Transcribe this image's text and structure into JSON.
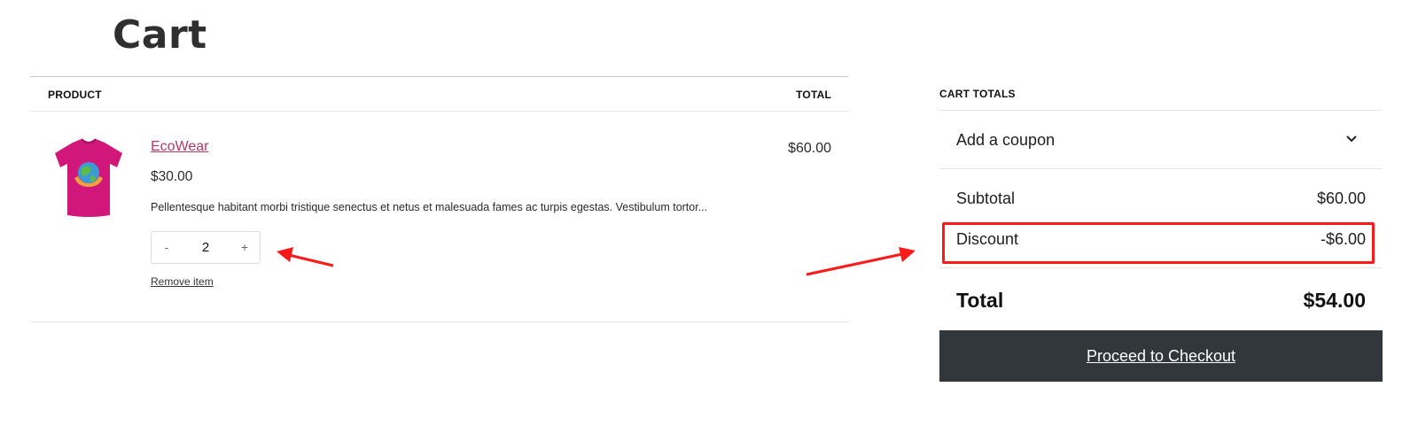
{
  "page": {
    "title": "Cart"
  },
  "cart_table": {
    "headers": {
      "product": "PRODUCT",
      "total": "TOTAL"
    },
    "items": [
      {
        "name": "EcoWear",
        "price": "$30.00",
        "description": "Pellentesque habitant morbi tristique senectus et netus et malesuada fames ac turpis egestas. Vestibulum tortor...",
        "quantity": "2",
        "qty_minus": "-",
        "qty_plus": "+",
        "remove_label": "Remove item",
        "line_total": "$60.00",
        "image_icon": "tshirt-icon"
      }
    ]
  },
  "totals": {
    "heading": "CART TOTALS",
    "coupon_label": "Add a coupon",
    "subtotal_label": "Subtotal",
    "subtotal_value": "$60.00",
    "discount_label": "Discount",
    "discount_value": "-$6.00",
    "total_label": "Total",
    "total_value": "$54.00",
    "checkout_label": "Proceed to Checkout"
  },
  "colors": {
    "product_link": "#b53a6b",
    "checkout_button": "#32373c",
    "annotation": "#ff1a1a",
    "tshirt": "#d1187a"
  }
}
